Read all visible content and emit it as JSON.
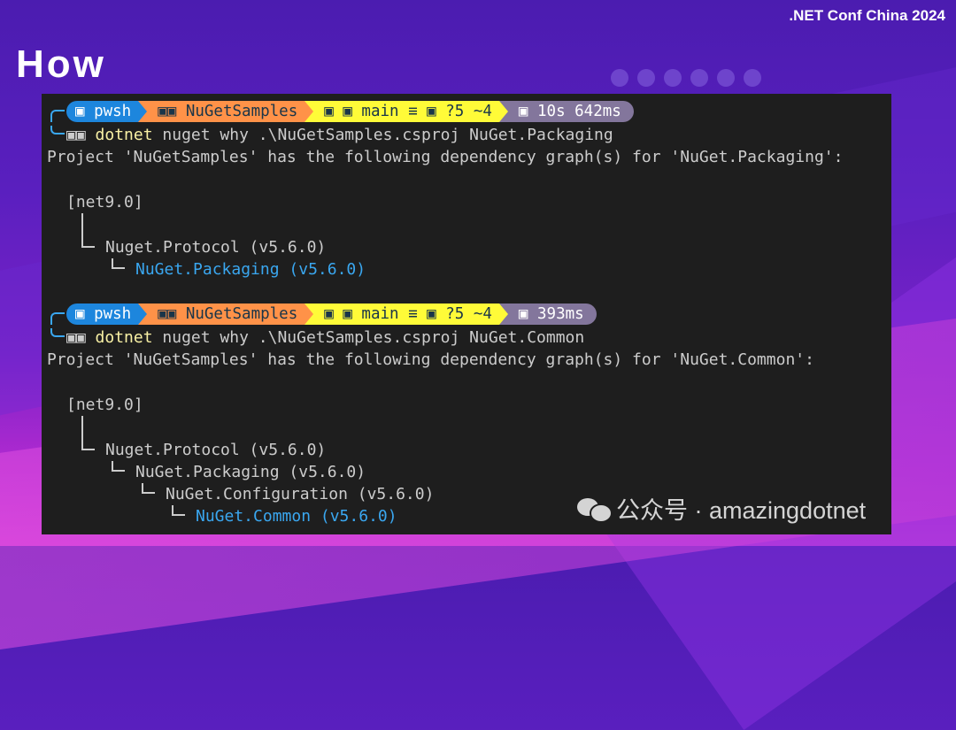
{
  "header": {
    "conference": ".NET Conf China 2024",
    "heading": "How"
  },
  "terminal": {
    "blocks": [
      {
        "prompt": {
          "shell": "▣ pwsh",
          "path": "▣▣ NuGetSamples",
          "git": "▣ ▣ main ≡ ▣ ?5 ~4",
          "time": "▣ 10s 642ms"
        },
        "command_glyph": "▣▣",
        "command_exe": "dotnet",
        "command_args": " nuget why .\\NuGetSamples.csproj NuGet.Packaging",
        "result_line": "Project 'NuGetSamples' has the following dependency graph(s) for 'NuGet.Packaging':",
        "framework": "[net9.0]",
        "tree": [
          "Nuget.Protocol (v5.6.0)",
          "NuGet.Packaging (v5.6.0)"
        ]
      },
      {
        "prompt": {
          "shell": "▣ pwsh",
          "path": "▣▣ NuGetSamples",
          "git": "▣ ▣ main ≡ ▣ ?5 ~4",
          "time": "▣ 393ms"
        },
        "command_glyph": "▣▣",
        "command_exe": "dotnet",
        "command_args": " nuget why .\\NuGetSamples.csproj NuGet.Common",
        "result_line": "Project 'NuGetSamples' has the following dependency graph(s) for 'NuGet.Common':",
        "framework": "[net9.0]",
        "tree": [
          "Nuget.Protocol (v5.6.0)",
          "NuGet.Packaging (v5.6.0)",
          "NuGet.Configuration (v5.6.0)",
          "NuGet.Common (v5.6.0)"
        ]
      }
    ]
  },
  "watermark": {
    "text": "公众号 · amazingdotnet"
  },
  "colors": {
    "terminal_bg": "#1e1e1e",
    "pwsh_segment": "#1d86dd",
    "path_segment": "#ff9248",
    "git_segment": "#fffb38",
    "time_segment": "#83769c",
    "highlight": "#3aa7f0"
  }
}
